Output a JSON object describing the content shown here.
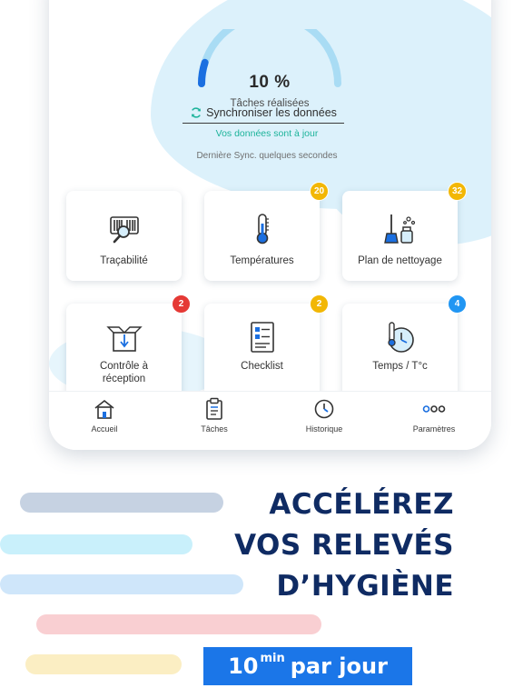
{
  "progress": {
    "value_text": "10 %",
    "fraction": 0.1,
    "label": "Tâches réalisées"
  },
  "sync": {
    "button_label": "Synchroniser les données",
    "status": "Vos données sont à jour",
    "last": "Dernière Sync. quelques secondes"
  },
  "tiles": [
    {
      "label": "Traçabilité",
      "icon": "barcode-scan-icon"
    },
    {
      "label": "Températures",
      "icon": "thermometer-icon",
      "badge": "20",
      "badge_color": "#f2b705"
    },
    {
      "label": "Plan de nettoyage",
      "icon": "cleaning-icon",
      "badge": "32",
      "badge_color": "#f2b705"
    },
    {
      "label": "Contrôle à réception",
      "icon": "box-receive-icon",
      "badge": "2",
      "badge_color": "#e53935"
    },
    {
      "label": "Checklist",
      "icon": "checklist-icon",
      "badge": "2",
      "badge_color": "#f2b705"
    },
    {
      "label": "Temps / T°c",
      "icon": "clock-thermometer-icon",
      "badge": "4",
      "badge_color": "#2196f3"
    }
  ],
  "nav": [
    {
      "label": "Accueil",
      "icon": "home-icon"
    },
    {
      "label": "Tâches",
      "icon": "clipboard-icon"
    },
    {
      "label": "Historique",
      "icon": "history-icon"
    },
    {
      "label": "Paramètres",
      "icon": "more-icon"
    }
  ],
  "marketing": {
    "line1": "ACCÉLÉREZ",
    "line2": "VOS RELEVÉS",
    "line3": "D’HYGIÈNE",
    "tagline_number": "10",
    "tagline_unit": "min",
    "tagline_rest": "par jour"
  },
  "colors": {
    "accent_blue": "#1b76e8",
    "navy": "#0f2b63",
    "teal": "#1cb39a",
    "stripe_grey": "#c6d2e2",
    "stripe_cyan": "#c9f0fb",
    "stripe_blue": "#cfe6fa",
    "stripe_pink": "#f9cfd2",
    "stripe_yellow": "#fbeec3"
  }
}
